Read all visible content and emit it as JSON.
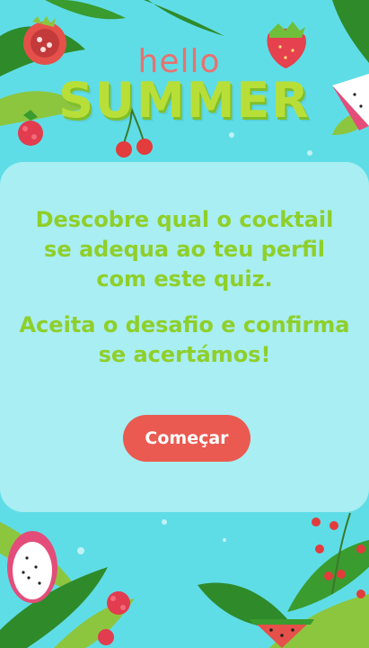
{
  "header": {
    "hello": "hello",
    "summer": "SUMMER"
  },
  "intro": {
    "line1": "Descobre qual o cocktail se adequa ao teu perfil com este quiz.",
    "line2": "Aceita o desafio e confirma se acertámos!"
  },
  "actions": {
    "start_label": "Começar"
  },
  "colors": {
    "background": "#5fdde6",
    "card": "#a8eef2",
    "text": "#8fcf2a",
    "button": "#ea5a50"
  }
}
